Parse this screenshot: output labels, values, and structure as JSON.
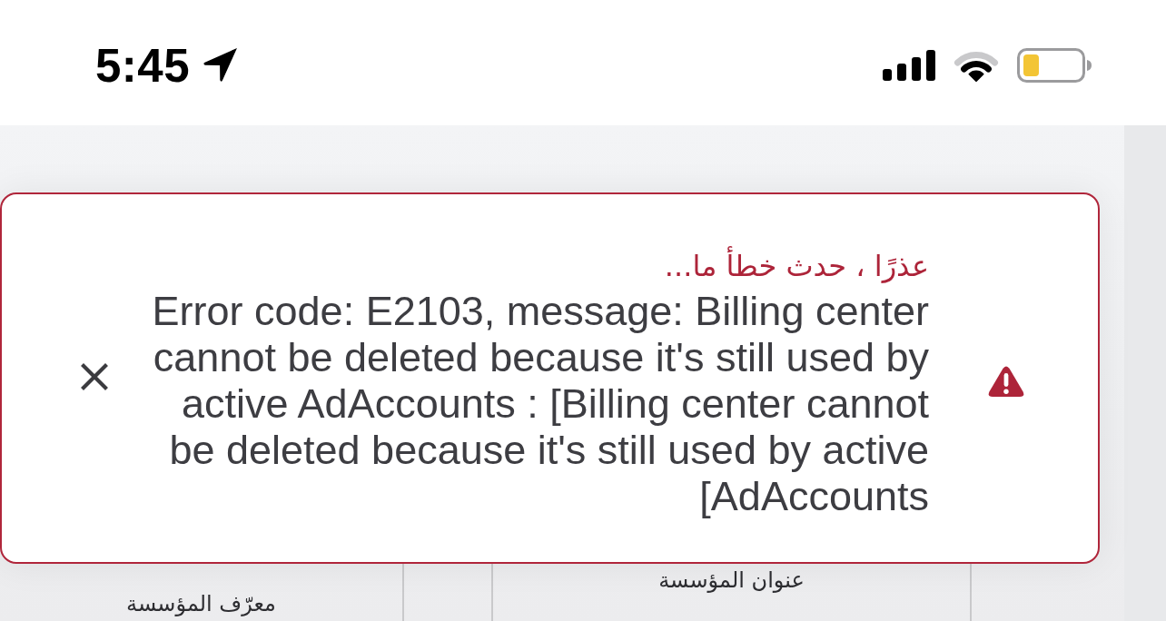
{
  "status_bar": {
    "time": "5:45"
  },
  "table": {
    "columns": [
      {
        "label": "عنوان المؤسسة"
      },
      {
        "label": "معرّف المؤسسة"
      }
    ]
  },
  "toast": {
    "kind": "error",
    "title": "عذرًا ، حدث خطأ ما...",
    "message": "Error code: E2103, message: Billing center cannot be deleted because it's still used by active AdAccounts : [Billing center cannot be deleted because it's still used by active [AdAccounts"
  }
}
